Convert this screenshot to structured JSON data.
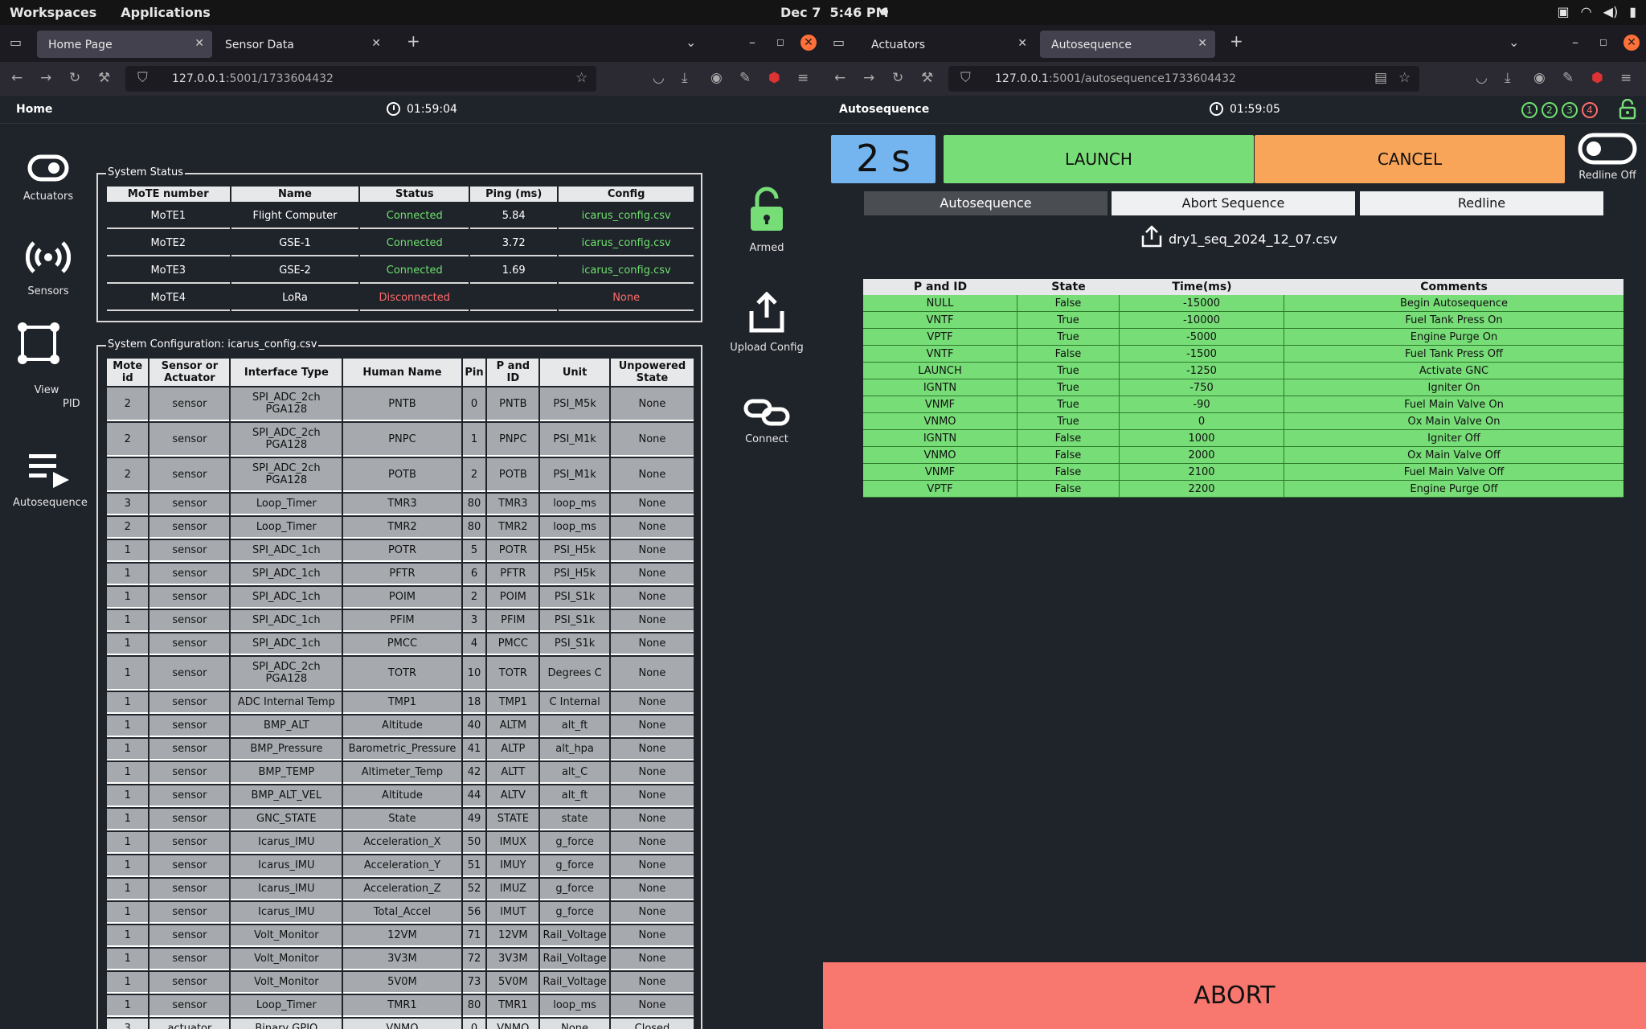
{
  "topbar": {
    "workspaces": "Workspaces",
    "applications": "Applications",
    "date": "Dec 7",
    "time": "5:46 PM"
  },
  "left": {
    "tabs": [
      {
        "label": "Home Page"
      },
      {
        "label": "Sensor Data"
      }
    ],
    "url_host": "127.0.0.1",
    "url_rest": ":5001/1733604432",
    "title": "Home",
    "clock": "01:59:04",
    "sidebar": [
      {
        "label": "Actuators"
      },
      {
        "label": "Sensors"
      },
      {
        "label": "PID"
      },
      {
        "label": "View"
      },
      {
        "label": "Autosequence"
      }
    ],
    "status_legend": "System Status",
    "status_headers": [
      "MoTE number",
      "Name",
      "Status",
      "Ping (ms)",
      "Config"
    ],
    "status_rows": [
      [
        "MoTE1",
        "Flight Computer",
        "Connected",
        "5.84",
        "icarus_config.csv"
      ],
      [
        "MoTE2",
        "GSE-1",
        "Connected",
        "3.72",
        "icarus_config.csv"
      ],
      [
        "MoTE3",
        "GSE-2",
        "Connected",
        "1.69",
        "icarus_config.csv"
      ],
      [
        "MoTE4",
        "LoRa",
        "Disconnected",
        "",
        "None"
      ]
    ],
    "config_legend": "System Configuration: icarus_config.csv",
    "config_headers": [
      "Mote id",
      "Sensor or Actuator",
      "Interface Type",
      "Human Name",
      "Pin",
      "P and ID",
      "Unit",
      "Unpowered State"
    ],
    "config_rows": [
      [
        "2",
        "sensor",
        "SPI_ADC_2ch PGA128",
        "PNTB",
        "0",
        "PNTB",
        "PSI_M5k",
        "None"
      ],
      [
        "2",
        "sensor",
        "SPI_ADC_2ch PGA128",
        "PNPC",
        "1",
        "PNPC",
        "PSI_M1k",
        "None"
      ],
      [
        "2",
        "sensor",
        "SPI_ADC_2ch PGA128",
        "POTB",
        "2",
        "POTB",
        "PSI_M1k",
        "None"
      ],
      [
        "3",
        "sensor",
        "Loop_Timer",
        "TMR3",
        "80",
        "TMR3",
        "loop_ms",
        "None"
      ],
      [
        "2",
        "sensor",
        "Loop_Timer",
        "TMR2",
        "80",
        "TMR2",
        "loop_ms",
        "None"
      ],
      [
        "1",
        "sensor",
        "SPI_ADC_1ch",
        "POTR",
        "5",
        "POTR",
        "PSI_H5k",
        "None"
      ],
      [
        "1",
        "sensor",
        "SPI_ADC_1ch",
        "PFTR",
        "6",
        "PFTR",
        "PSI_H5k",
        "None"
      ],
      [
        "1",
        "sensor",
        "SPI_ADC_1ch",
        "POIM",
        "2",
        "POIM",
        "PSI_S1k",
        "None"
      ],
      [
        "1",
        "sensor",
        "SPI_ADC_1ch",
        "PFIM",
        "3",
        "PFIM",
        "PSI_S1k",
        "None"
      ],
      [
        "1",
        "sensor",
        "SPI_ADC_1ch",
        "PMCC",
        "4",
        "PMCC",
        "PSI_S1k",
        "None"
      ],
      [
        "1",
        "sensor",
        "SPI_ADC_2ch PGA128",
        "TOTR",
        "10",
        "TOTR",
        "Degrees C",
        "None"
      ],
      [
        "1",
        "sensor",
        "ADC Internal Temp",
        "TMP1",
        "18",
        "TMP1",
        "C Internal",
        "None"
      ],
      [
        "1",
        "sensor",
        "BMP_ALT",
        "Altitude",
        "40",
        "ALTM",
        "alt_ft",
        "None"
      ],
      [
        "1",
        "sensor",
        "BMP_Pressure",
        "Barometric_Pressure",
        "41",
        "ALTP",
        "alt_hpa",
        "None"
      ],
      [
        "1",
        "sensor",
        "BMP_TEMP",
        "Altimeter_Temp",
        "42",
        "ALTT",
        "alt_C",
        "None"
      ],
      [
        "1",
        "sensor",
        "BMP_ALT_VEL",
        "Altitude",
        "44",
        "ALTV",
        "alt_ft",
        "None"
      ],
      [
        "1",
        "sensor",
        "GNC_STATE",
        "State",
        "49",
        "STATE",
        "state",
        "None"
      ],
      [
        "1",
        "sensor",
        "Icarus_IMU",
        "Acceleration_X",
        "50",
        "IMUX",
        "g_force",
        "None"
      ],
      [
        "1",
        "sensor",
        "Icarus_IMU",
        "Acceleration_Y",
        "51",
        "IMUY",
        "g_force",
        "None"
      ],
      [
        "1",
        "sensor",
        "Icarus_IMU",
        "Acceleration_Z",
        "52",
        "IMUZ",
        "g_force",
        "None"
      ],
      [
        "1",
        "sensor",
        "Icarus_IMU",
        "Total_Accel",
        "56",
        "IMUT",
        "g_force",
        "None"
      ],
      [
        "1",
        "sensor",
        "Volt_Monitor",
        "12VM",
        "71",
        "12VM",
        "Rail_Voltage",
        "None"
      ],
      [
        "1",
        "sensor",
        "Volt_Monitor",
        "3V3M",
        "72",
        "3V3M",
        "Rail_Voltage",
        "None"
      ],
      [
        "1",
        "sensor",
        "Volt_Monitor",
        "5V0M",
        "73",
        "5V0M",
        "Rail_Voltage",
        "None"
      ],
      [
        "1",
        "sensor",
        "Loop_Timer",
        "TMR1",
        "80",
        "TMR1",
        "loop_ms",
        "None"
      ],
      [
        "3",
        "actuator",
        "Binary GPIO",
        "VNMO",
        "0",
        "VNMO",
        "None",
        "Closed"
      ]
    ],
    "right_icons": [
      {
        "label": "Armed"
      },
      {
        "label": "Upload Config"
      },
      {
        "label": "Connect"
      }
    ]
  },
  "right": {
    "tabs": [
      {
        "label": "Actuators"
      },
      {
        "label": "Autosequence"
      }
    ],
    "url_host": "127.0.0.1",
    "url_rest": ":5001/autosequence1733604432",
    "title": "Autosequence",
    "clock": "01:59:05",
    "mote_indicators": [
      "1",
      "2",
      "3",
      "4"
    ],
    "countdown": "2 s",
    "launch": "LAUNCH",
    "cancel": "CANCEL",
    "redline_label": "Redline Off",
    "seq_tabs": [
      "Autosequence",
      "Abort Sequence",
      "Redline"
    ],
    "file_name": "dry1_seq_2024_12_07.csv",
    "seq_headers": [
      "P and ID",
      "State",
      "Time(ms)",
      "Comments"
    ],
    "seq_rows": [
      [
        "NULL",
        "False",
        "-15000",
        "Begin Autosequence"
      ],
      [
        "VNTF",
        "True",
        "-10000",
        "Fuel Tank Press On"
      ],
      [
        "VPTF",
        "True",
        "-5000",
        "Engine Purge On"
      ],
      [
        "VNTF",
        "False",
        "-1500",
        "Fuel Tank Press Off"
      ],
      [
        "LAUNCH",
        "True",
        "-1250",
        "Activate GNC"
      ],
      [
        "IGNTN",
        "True",
        "-750",
        "Igniter On"
      ],
      [
        "VNMF",
        "True",
        "-90",
        "Fuel Main Valve On"
      ],
      [
        "VNMO",
        "True",
        "0",
        "Ox Main Valve On"
      ],
      [
        "IGNTN",
        "False",
        "1000",
        "Igniter Off"
      ],
      [
        "VNMO",
        "False",
        "2000",
        "Ox Main Valve Off"
      ],
      [
        "VNMF",
        "False",
        "2100",
        "Fuel Main Valve Off"
      ],
      [
        "VPTF",
        "False",
        "2200",
        "Engine Purge Off"
      ]
    ],
    "abort": "ABORT"
  },
  "colors": {
    "green": "#77dd77",
    "orange": "#f8a55a",
    "blue": "#74b4ef",
    "abort": "#f8776f",
    "connected": "#6ee06e",
    "disconnected": "#ff6b6b"
  }
}
